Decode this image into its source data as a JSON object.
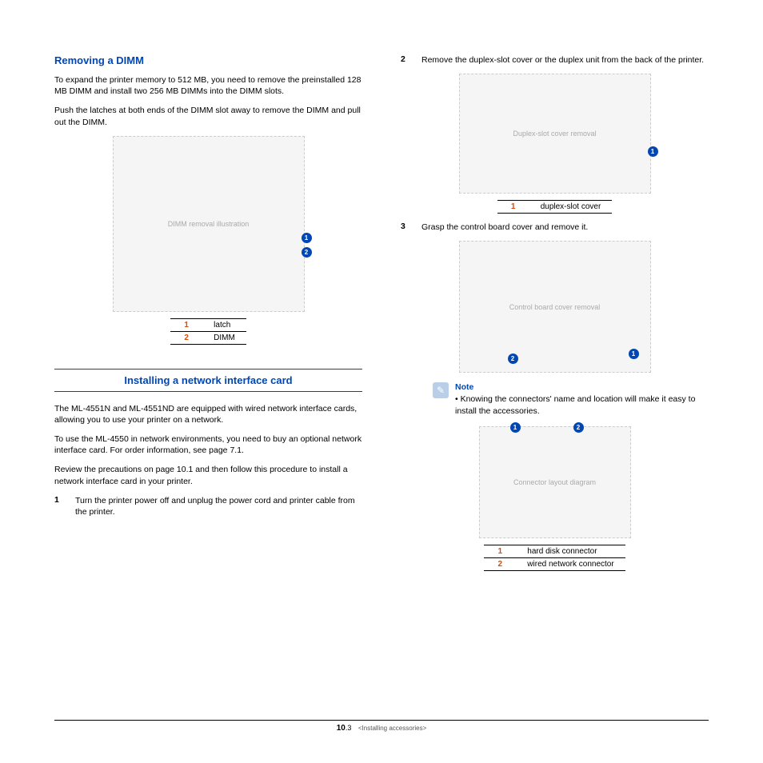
{
  "left": {
    "heading1": "Removing a DIMM",
    "p1": "To expand the printer memory to 512 MB, you need to remove the preinstalled 128 MB DIMM and install two 256 MB DIMMs into the DIMM slots.",
    "p2": "Push the latches at both ends of the DIMM slot away to remove the DIMM and pull out the DIMM.",
    "fig1_alt": "DIMM removal illustration",
    "legend1": [
      {
        "num": "1",
        "label": "latch"
      },
      {
        "num": "2",
        "label": "DIMM"
      }
    ],
    "heading2": "Installing a network interface card",
    "p3": "The ML-4551N and ML-4551ND are equipped with wired network interface cards, allowing you to use your printer on a network.",
    "p4": "To use the ML-4550 in network environments, you need to buy an optional network interface card. For order information, see page 7.1.",
    "p5": "Review the precautions on page 10.1 and then follow this procedure to install a network interface card in your printer.",
    "step1_num": "1",
    "step1_text": "Turn the printer power off and unplug the power cord and printer cable from the printer."
  },
  "right": {
    "step2_num": "2",
    "step2_text": "Remove the duplex-slot cover or the duplex unit from the back of the printer.",
    "fig2_alt": "Duplex-slot cover removal",
    "legend2": [
      {
        "num": "1",
        "label": "duplex-slot cover"
      }
    ],
    "step3_num": "3",
    "step3_text": "Grasp the control board cover and remove it.",
    "fig3_alt": "Control board cover removal",
    "note_title": "Note",
    "note_text": "Knowing the connectors' name and location will make it easy to install the accessories.",
    "fig4_alt": "Connector layout diagram",
    "legend3": [
      {
        "num": "1",
        "label": "hard disk connector"
      },
      {
        "num": "2",
        "label": "wired network connector"
      }
    ]
  },
  "callouts": {
    "c1": "1",
    "c2": "2"
  },
  "footer": {
    "page": "10",
    "sub": ".3",
    "section": "<Installing accessories>"
  }
}
